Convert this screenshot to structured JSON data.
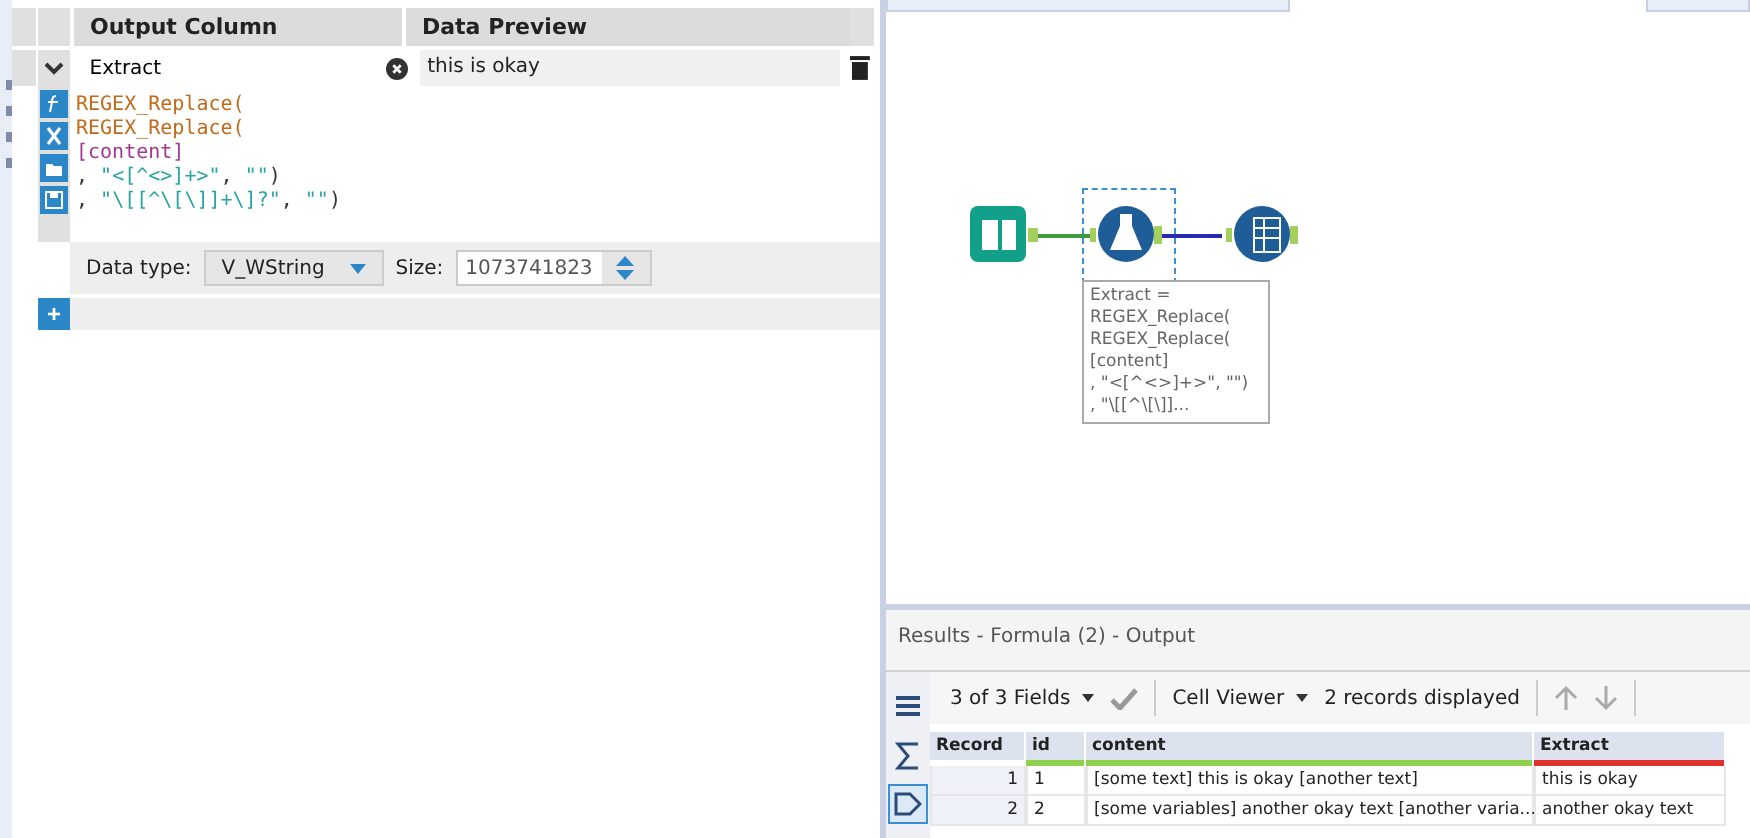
{
  "formula_panel": {
    "columns": [
      "Output Column",
      "Data Preview"
    ],
    "field": {
      "value": "Extract",
      "preview": "this is okay",
      "expanded": true
    },
    "expression": [
      [
        {
          "text": "REGEX_Replace(",
          "kind": "function"
        }
      ],
      [
        {
          "text": "REGEX_Replace(",
          "kind": "function"
        }
      ],
      [
        {
          "text": "[content]",
          "kind": "field"
        }
      ],
      [
        {
          "text": ", ",
          "kind": "plain"
        },
        {
          "text": "\"<[^<>]+>\"",
          "kind": "string"
        },
        {
          "text": ", ",
          "kind": "plain"
        },
        {
          "text": "\"\"",
          "kind": "string"
        },
        {
          "text": ")",
          "kind": "plain"
        }
      ],
      [
        {
          "text": ", ",
          "kind": "plain"
        },
        {
          "text": "\"\\[[^\\[\\]]+\\]?\"",
          "kind": "string"
        },
        {
          "text": ", ",
          "kind": "plain"
        },
        {
          "text": "\"\"",
          "kind": "string"
        },
        {
          "text": ")",
          "kind": "plain"
        }
      ]
    ],
    "data_type_label": "Data type:",
    "data_type": "V_WString",
    "size_label": "Size:",
    "size": "1073741823",
    "add_button": "+"
  },
  "canvas": {
    "annotation": [
      "Extract =",
      "REGEX_Replace(",
      "REGEX_Replace(",
      "[content]",
      ", \"<[^<>]+>\", \"\")",
      ", \"\\[[^\\[\\]]..."
    ]
  },
  "results": {
    "title": "Results - Formula (2) - Output",
    "fields": "3 of 3 Fields",
    "viewer": "Cell Viewer",
    "records_displayed": "2 records displayed",
    "side_tools": [
      {
        "kind": "list",
        "selected": false
      },
      {
        "kind": "sigma",
        "selected": false
      },
      {
        "kind": "tag",
        "selected": true
      }
    ],
    "table": {
      "columns": [
        {
          "name": "Record",
          "color": "#ffffff"
        },
        {
          "name": "id",
          "color": "#8fd14f"
        },
        {
          "name": "content",
          "color": "#8fd14f"
        },
        {
          "name": "Extract",
          "color": "#e03030"
        }
      ],
      "rows": [
        [
          "1",
          "1",
          "[some text] this is okay [another text]",
          "this is okay"
        ],
        [
          "2",
          "2",
          "[some variables] another okay text [another varia...",
          "another okay text"
        ]
      ]
    }
  }
}
